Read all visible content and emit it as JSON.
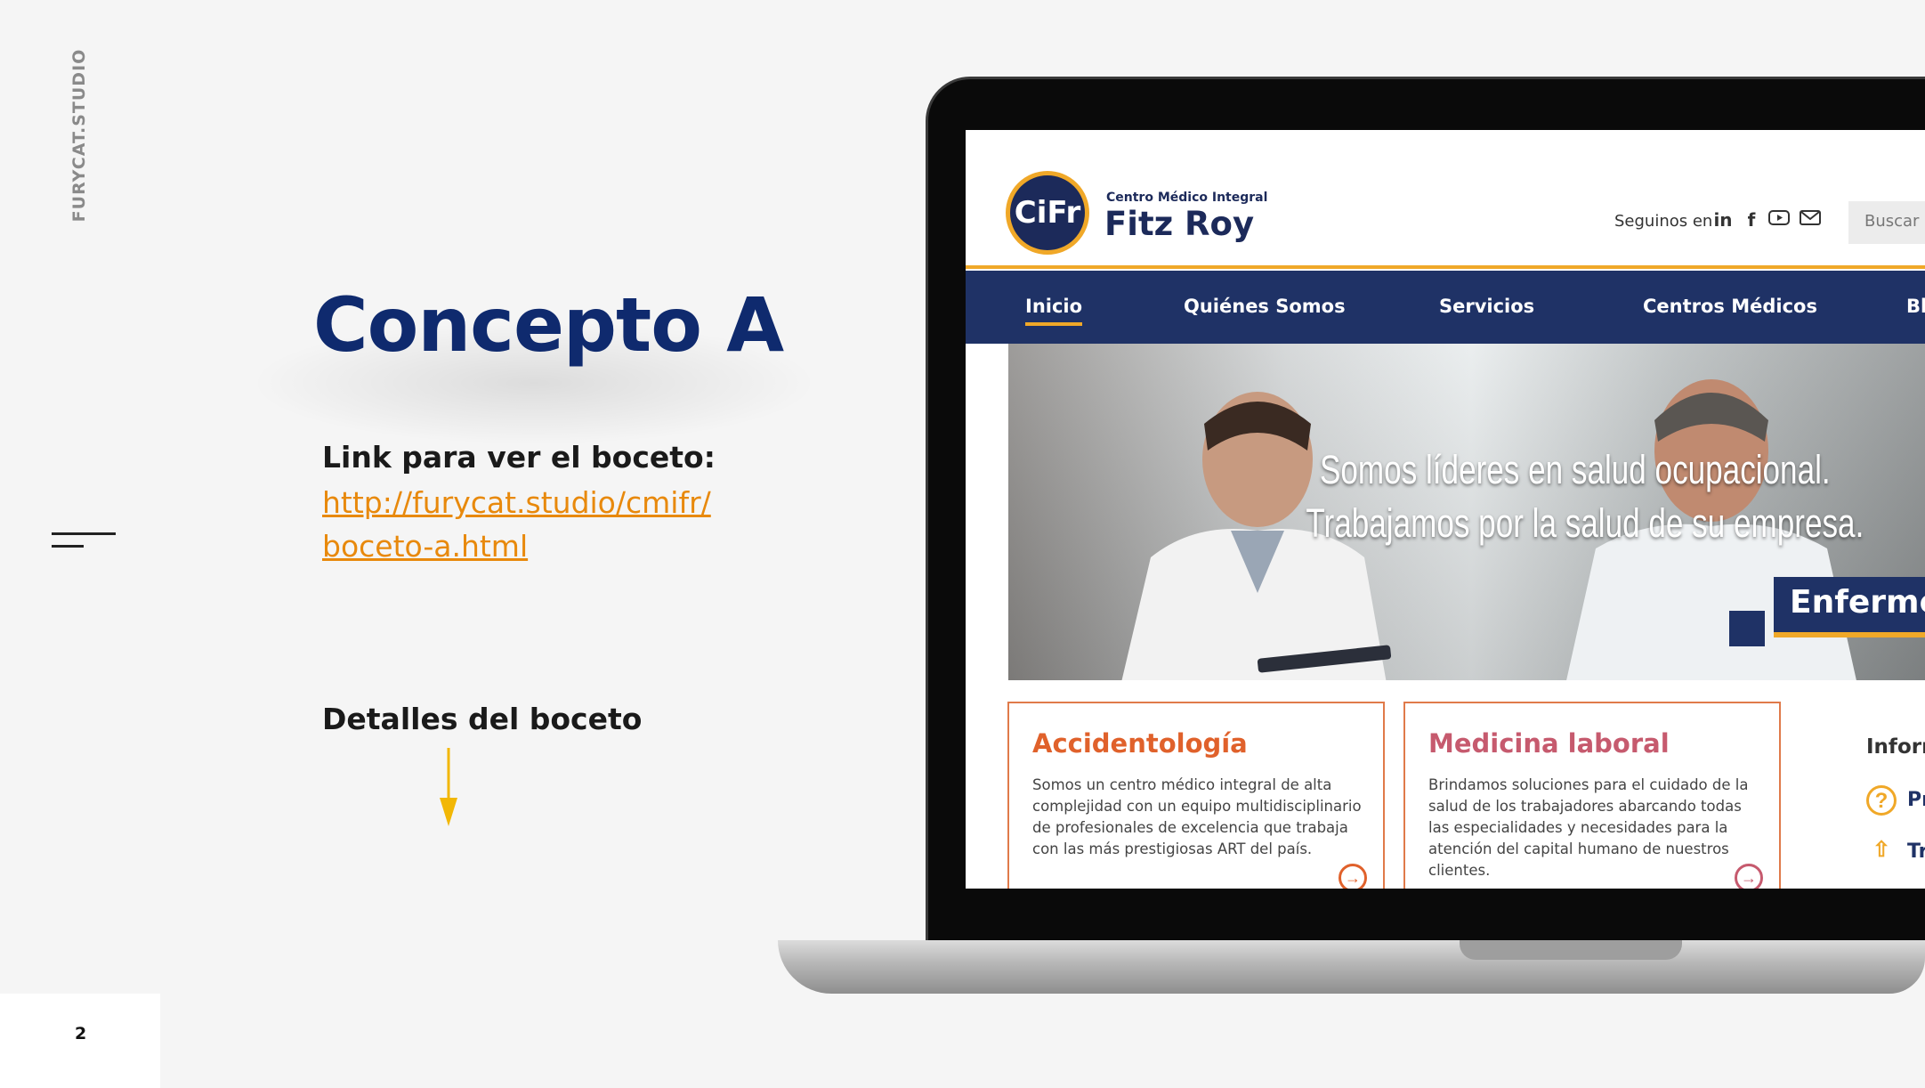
{
  "slide": {
    "brand_vertical": "FURYCAT.STUDIO",
    "page_number": "2",
    "title": "Concepto A",
    "link_label": "Link para ver el boceto:",
    "link_url_line1": "http://furycat.studio/cmifr/",
    "link_url_line2": "boceto-a.html",
    "details_label": "Detalles del boceto",
    "accent_color": "#e8890c",
    "title_color": "#0f2a6e"
  },
  "mockup": {
    "logo_mark": "CiFr",
    "logo_sub": "Centro Médico Integral",
    "logo_main": "Fitz Roy",
    "follow_label": "Seguinos en",
    "social_icons": [
      "linkedin-icon",
      "facebook-icon",
      "youtube-icon",
      "mail-icon"
    ],
    "search_placeholder": "Buscar e",
    "nav": [
      "Inicio",
      "Quiénes Somos",
      "Servicios",
      "Centros Médicos",
      "Bl"
    ],
    "hero_line1": "Somos líderes en salud ocupacional.",
    "hero_line2": "Trabajamos por la salud de su empresa.",
    "hero_tag": "Enfermerí",
    "cards": [
      {
        "title": "Accidentología",
        "text": "Somos un centro médico integral de alta complejidad con un equipo multidisciplinario de profesionales de excelencia que trabaja con las más prestigiosas ART del país.",
        "color": "#e0612b"
      },
      {
        "title": "Medicina laboral",
        "text": "Brindamos soluciones para el cuidado de la salud de los trabajadores abarcando todas las especialidades y necesidades para la atención del capital humano de nuestros clientes.",
        "color": "#c65a6e"
      }
    ],
    "info_title": "Inforn",
    "info_items": [
      "Pr",
      "Tr"
    ],
    "nav_color": "#1f3266",
    "highlight_color": "#f0a828"
  }
}
